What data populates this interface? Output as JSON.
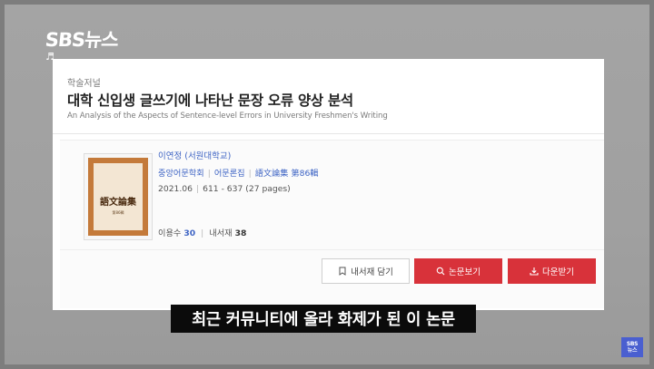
{
  "broadcast": {
    "logo_text": "SBS뉴스",
    "music_icon": "music-note-icon",
    "subtitle": "최근 커뮤니티에 올라 화제가 된 이 논문",
    "corner_logo_line1": "SBS",
    "corner_logo_line2": "뉴스"
  },
  "paper": {
    "category": "학술저널",
    "title_kr": "대학 신입생 글쓰기에 나타난 문장 오류 양상 분석",
    "title_en": "An Analysis of the Aspects of Sentence-level Errors in University Freshmen's Writing",
    "author": "이연정 (서원대학교)",
    "publisher": "중앙어문학회",
    "journal": "어문론집",
    "issue": "語文論集 第86輯",
    "date": "2021.06",
    "pages": "611 - 637 (27 pages)",
    "cover_title": "語文論集",
    "cover_sub": "第86輯",
    "stats": {
      "usage_label": "이용수",
      "usage_count": "30",
      "library_label": "내서재",
      "library_count": "38"
    }
  },
  "actions": {
    "save_label": "내서재 담기",
    "view_label": "논문보기",
    "download_label": "다운받기"
  },
  "colors": {
    "accent_red": "#d8323a",
    "link_blue": "#3e64c4"
  }
}
